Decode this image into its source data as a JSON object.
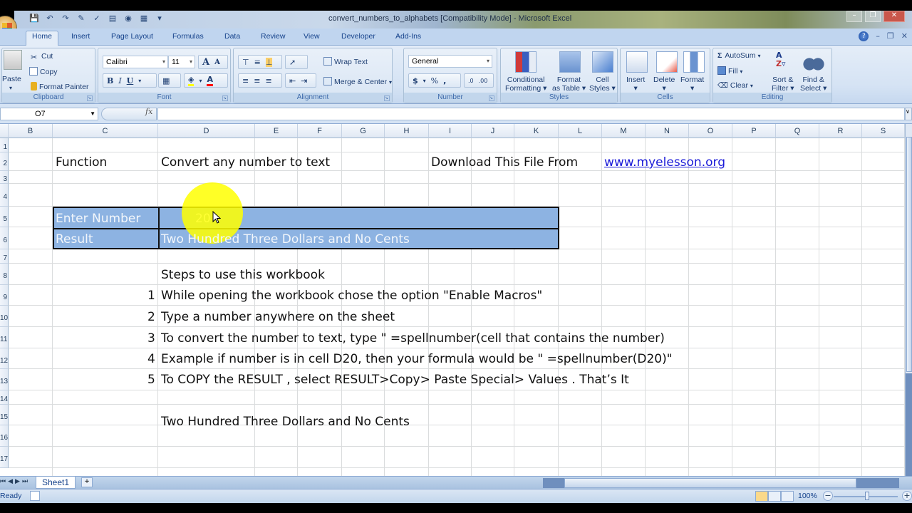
{
  "window": {
    "title": "convert_numbers_to_alphabets  [Compatibility Mode] - Microsoft Excel"
  },
  "ribbon_tabs": [
    "Home",
    "Insert",
    "Page Layout",
    "Formulas",
    "Data",
    "Review",
    "View",
    "Developer",
    "Add-Ins"
  ],
  "active_tab": "Home",
  "clipboard": {
    "paste": "Paste",
    "cut": "Cut",
    "copy": "Copy",
    "format_painter": "Format Painter",
    "label": "Clipboard"
  },
  "font": {
    "family": "Calibri",
    "size": "11",
    "bold": "B",
    "italic": "I",
    "underline": "U",
    "label": "Font"
  },
  "alignment": {
    "wrap_text": "Wrap Text",
    "merge_center": "Merge & Center",
    "label": "Alignment"
  },
  "number": {
    "format": "General",
    "currency": "$",
    "percent": "%",
    "comma": ",",
    "label": "Number"
  },
  "styles": {
    "conditional_1": "Conditional",
    "conditional_2": "Formatting",
    "format_table_1": "Format",
    "format_table_2": "as Table",
    "cell_styles_1": "Cell",
    "cell_styles_2": "Styles",
    "label": "Styles"
  },
  "cells": {
    "insert": "Insert",
    "delete": "Delete",
    "format": "Format",
    "label": "Cells"
  },
  "editing": {
    "autosum": "AutoSum",
    "fill": "Fill",
    "clear": "Clear",
    "sort_1": "Sort &",
    "sort_2": "Filter",
    "find_1": "Find &",
    "find_2": "Select",
    "label": "Editing"
  },
  "formula_bar": {
    "name_box": "O7",
    "fx": "fx",
    "formula": ""
  },
  "columns": [
    "B",
    "C",
    "D",
    "E",
    "F",
    "G",
    "H",
    "I",
    "J",
    "K",
    "L",
    "M",
    "N",
    "O",
    "P",
    "Q",
    "R",
    "S"
  ],
  "rows": [
    "1",
    "2",
    "3",
    "4",
    "5",
    "6",
    "7",
    "8",
    "9",
    "10",
    "11",
    "12",
    "13",
    "14",
    "15",
    "16",
    "17"
  ],
  "sheet": {
    "function_label": "Function",
    "function_desc": "Convert any number to text",
    "download_label": "Download This File From",
    "download_link": "www.myelesson.org",
    "enter_number_label": "Enter Number",
    "enter_number_value": "20",
    "result_label": "Result",
    "result_value": "Two Hundred Three Dollars and No Cents",
    "steps_title": "Steps to use this workbook",
    "steps": [
      {
        "num": "1",
        "text": "While opening the workbook chose the option \"Enable Macros\""
      },
      {
        "num": "2",
        "text": "Type a number anywhere on the sheet"
      },
      {
        "num": "3",
        "text": "To convert the number to text, type \" =spellnumber(cell that contains the number)"
      },
      {
        "num": "4",
        "text": "Example if number is in cell D20, then your formula would be \" =spellnumber(D20)\""
      },
      {
        "num": "5",
        "text": "To COPY the RESULT , select RESULT>Copy> Paste Special> Values . That’s It"
      }
    ],
    "pasted_value": "Two Hundred Three Dollars and No Cents"
  },
  "sheet_tabs": [
    "Sheet1"
  ],
  "status": {
    "ready": "Ready",
    "zoom": "100%"
  },
  "colors": {
    "block_fill": "#8db3e2",
    "highlight": "#ffff00",
    "link": "#1a1ad8"
  }
}
